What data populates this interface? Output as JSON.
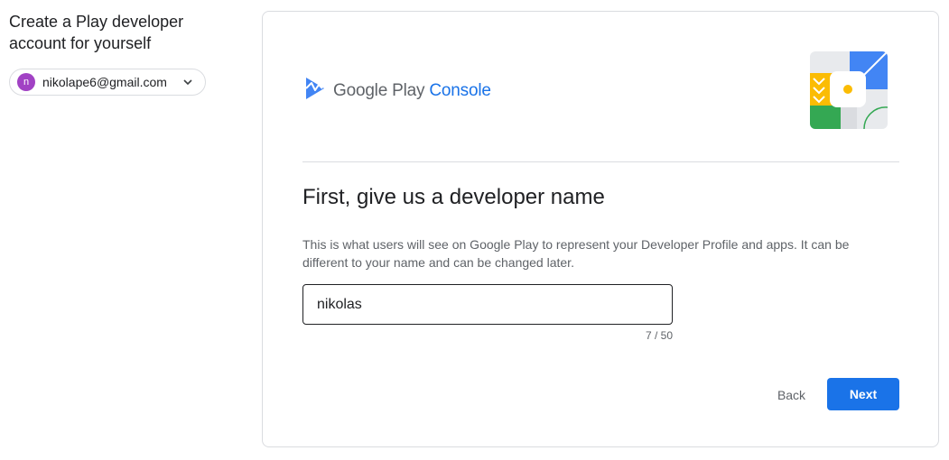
{
  "sidebar": {
    "title": "Create a Play developer account for yourself",
    "account": {
      "avatar_letter": "n",
      "avatar_color": "#a142c4",
      "email": "nikolape6@gmail.com",
      "dropdown_icon": "chevron-down-icon"
    }
  },
  "card": {
    "brand": {
      "google_play": "Google Play",
      "console": "Console",
      "logo_icon": "play-console-logo-icon"
    },
    "heading": "First, give us a developer name",
    "description": "This is what users will see on Google Play to represent your Developer Profile and apps. It can be different to your name and can be changed later.",
    "developer_name_field": {
      "value": "nikolas",
      "counter": "7 / 50"
    },
    "buttons": {
      "back": "Back",
      "next": "Next"
    }
  },
  "colors": {
    "accent": "#1a73e8",
    "text_primary": "#202124",
    "text_secondary": "#5f6368",
    "border": "#dadce0"
  }
}
